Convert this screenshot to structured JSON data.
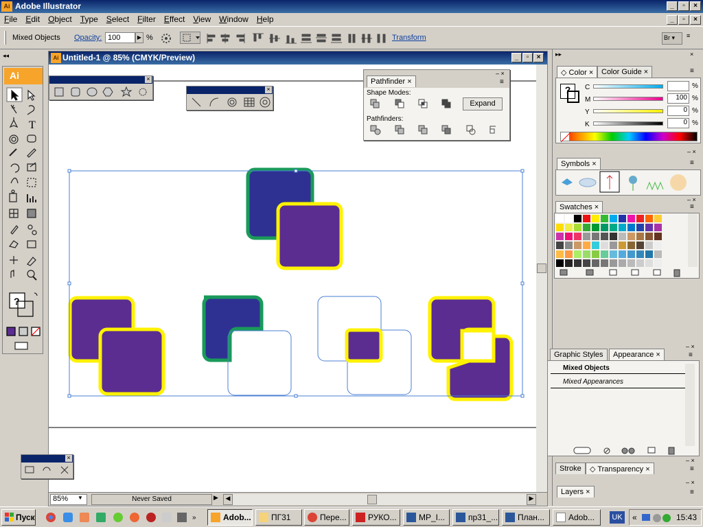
{
  "app": {
    "title": "Adobe Illustrator",
    "logo": "Ai"
  },
  "menu": [
    "File",
    "Edit",
    "Object",
    "Type",
    "Select",
    "Filter",
    "Effect",
    "View",
    "Window",
    "Help"
  ],
  "controlbar": {
    "selection_label": "Mixed Objects",
    "opacity_label": "Opacity:",
    "opacity_value": "100",
    "opacity_unit": "%",
    "transform_label": "Transform",
    "bridge_label": "Br"
  },
  "document": {
    "title": "Untitled-1 @ 85% (CMYK/Preview)",
    "zoom": "85%",
    "status": "Never Saved"
  },
  "pathfinder": {
    "title": "Pathfinder",
    "shape_modes_label": "Shape Modes:",
    "pathfinders_label": "Pathfinders:",
    "expand_label": "Expand"
  },
  "color_panel": {
    "tabs": [
      "Color",
      "Color Guide"
    ],
    "channels": [
      {
        "name": "C",
        "value": "",
        "unit": "%"
      },
      {
        "name": "M",
        "value": "100",
        "unit": "%"
      },
      {
        "name": "Y",
        "value": "0",
        "unit": "%"
      },
      {
        "name": "K",
        "value": "0",
        "unit": "%"
      }
    ]
  },
  "symbols_panel": {
    "tab": "Symbols"
  },
  "swatches_panel": {
    "tab": "Swatches"
  },
  "appearance_panel": {
    "tabs": [
      "Graphic Styles",
      "Appearance"
    ],
    "header": "Mixed Objects",
    "item": "Mixed Appearances"
  },
  "stroke_panel": {
    "tabs": [
      "Stroke",
      "Transparency"
    ]
  },
  "layers_panel": {
    "tab": "Layers"
  },
  "taskbar": {
    "start": "Пуск",
    "buttons": [
      "Adob...",
      "ПГ31",
      "Пере...",
      "РУКО...",
      "МР_I...",
      "пр31_...",
      "План...",
      "Adob..."
    ],
    "lang": "UK",
    "time": "15:43"
  },
  "colors": {
    "purple": "#5b2d91",
    "navy": "#2e3192",
    "green": "#1a9a5a",
    "yellow": "#fff200",
    "selection": "#4a7fd4"
  }
}
